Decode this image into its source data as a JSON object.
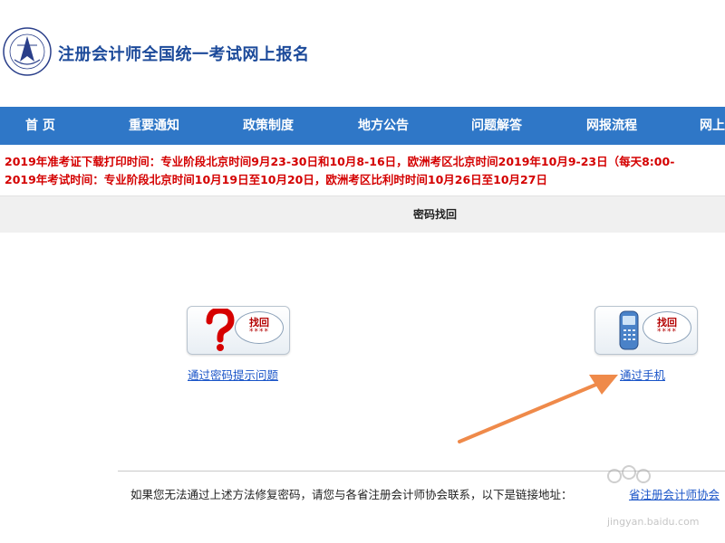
{
  "header": {
    "title": "注册会计师全国统一考试网上报名",
    "logo_icon": "cicpa-seal-icon"
  },
  "nav": {
    "items": [
      {
        "label": "首 页"
      },
      {
        "label": "重要通知"
      },
      {
        "label": "政策制度"
      },
      {
        "label": "地方公告"
      },
      {
        "label": "问题解答"
      },
      {
        "label": "网报流程"
      },
      {
        "label": "网上"
      }
    ],
    "color": "#2f77c7"
  },
  "notices": [
    "2019年准考证下载打印时间：专业阶段北京时间9月23-30日和10月8-16日，欧洲考区北京时间2019年10月9-23日（每天8:00-",
    "2019年考试时间：专业阶段北京时间10月19日至10月20日，欧洲考区比利时时间10月26日至10月27日"
  ],
  "section": {
    "title": "密码找回"
  },
  "options": [
    {
      "bubble": "找回",
      "stars": "****",
      "icon": "question-mark-icon",
      "link": "通过密码提示问题"
    },
    {
      "bubble": "找回",
      "stars": "****",
      "icon": "mobile-phone-icon",
      "link": "通过手机"
    }
  ],
  "footer": {
    "text": "如果您无法通过上述方法修复密码，请您与各省注册会计师协会联系，以下是链接地址：",
    "link": "省注册会计师协会"
  },
  "watermark": {
    "text": "jingyan.baidu.com"
  },
  "colors": {
    "brand_blue": "#1c4a9a",
    "notice_red": "#d40000",
    "link_blue": "#1a55c8",
    "arrow_orange": "#ef8a4a"
  }
}
